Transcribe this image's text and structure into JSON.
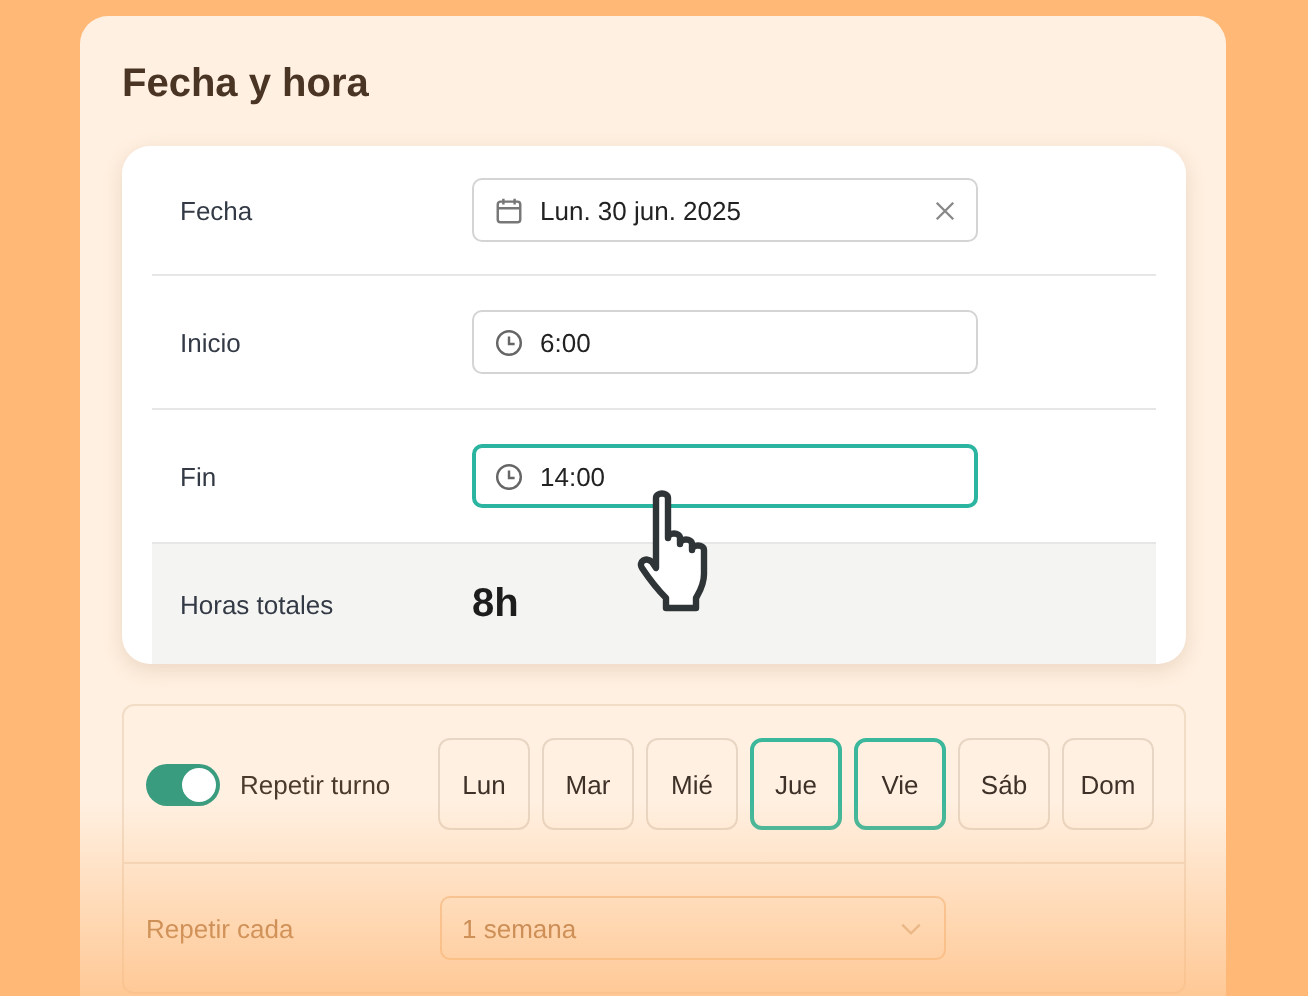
{
  "title": "Fecha y hora",
  "fields": [
    {
      "kind": "date",
      "label": "Fecha",
      "value": "Lun. 30 jun. 2025",
      "clearable": true,
      "focused": false
    },
    {
      "kind": "time",
      "label": "Inicio",
      "value": "6:00",
      "clearable": false,
      "focused": false
    },
    {
      "kind": "time",
      "label": "Fin",
      "value": "14:00",
      "clearable": false,
      "focused": true
    }
  ],
  "total": {
    "label": "Horas totales",
    "value": "8h"
  },
  "repeat": {
    "label": "Repetir turno",
    "on": true,
    "days": [
      {
        "label": "Lun",
        "selected": false
      },
      {
        "label": "Mar",
        "selected": false
      },
      {
        "label": "Mié",
        "selected": false
      },
      {
        "label": "Jue",
        "selected": true
      },
      {
        "label": "Vie",
        "selected": true
      },
      {
        "label": "Sáb",
        "selected": false
      },
      {
        "label": "Dom",
        "selected": false
      }
    ],
    "every_label": "Repetir cada",
    "every_value": "1 semana"
  }
}
